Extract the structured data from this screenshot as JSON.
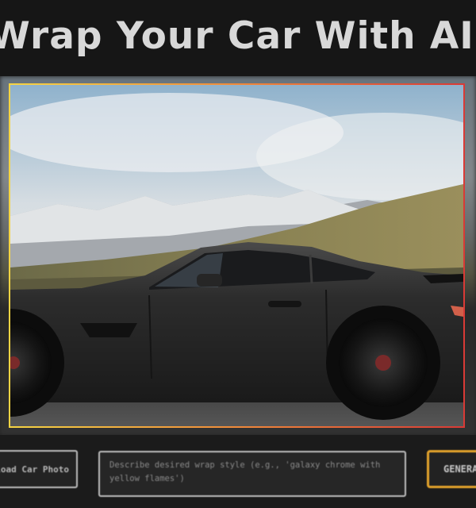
{
  "header": {
    "title": "Wrap Your Car With AI"
  },
  "preview": {
    "image_subject": "black sports coupe in front of snowy mountains"
  },
  "controls": {
    "upload_label": "Upload Car Photo",
    "prompt_placeholder": "Describe desired wrap style (e.g., 'galaxy chrome with yellow flames')",
    "prompt_value": "",
    "generate_label": "GENERATE"
  },
  "colors": {
    "frame_gradient": [
      "#f5d443",
      "#f08a3a",
      "#d93a36"
    ],
    "generate_border": "#e2a22b",
    "background": "#161616"
  }
}
